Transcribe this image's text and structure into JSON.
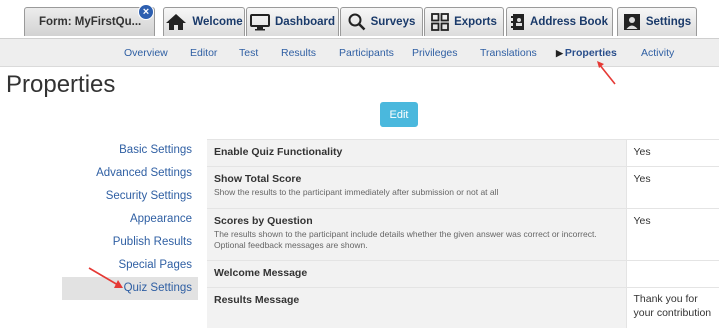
{
  "tabs": [
    {
      "label": "Form: MyFirstQu...",
      "icon": "form-icon"
    },
    {
      "label": "Welcome",
      "icon": "home-icon"
    },
    {
      "label": "Dashboard",
      "icon": "monitor-icon"
    },
    {
      "label": "Surveys",
      "icon": "search-icon"
    },
    {
      "label": "Exports",
      "icon": "grid-icon"
    },
    {
      "label": "Address Book",
      "icon": "address-book-icon"
    },
    {
      "label": "Settings",
      "icon": "user-card-icon"
    }
  ],
  "close_badge": "×",
  "subnav": [
    "Overview",
    "Editor",
    "Test",
    "Results",
    "Participants",
    "Privileges",
    "Translations",
    "Properties",
    "Activity"
  ],
  "page_title": "Properties",
  "edit_label": "Edit",
  "sidebar": [
    "Basic Settings",
    "Advanced Settings",
    "Security Settings",
    "Appearance",
    "Publish Results",
    "Special Pages",
    "Quiz Settings"
  ],
  "rows": [
    {
      "title": "Enable Quiz Functionality",
      "desc": "",
      "value": "Yes"
    },
    {
      "title": "Show Total Score",
      "desc": "Show the results to the participant immediately after submission or not at all",
      "value": "Yes"
    },
    {
      "title": "Scores by Question",
      "desc": "The results shown to the participant include details whether the given answer was correct or incorrect. Optional feedback messages are shown.",
      "value": "Yes"
    },
    {
      "title": "Welcome Message",
      "desc": "",
      "value": ""
    },
    {
      "title": "Results Message",
      "desc": "",
      "value": "Thank you for your contribution"
    }
  ],
  "colors": {
    "accent": "#4ab8dd",
    "link": "#2f5fa3",
    "annotation_arrow": "#e53935",
    "badge": "#2d5fb0"
  }
}
